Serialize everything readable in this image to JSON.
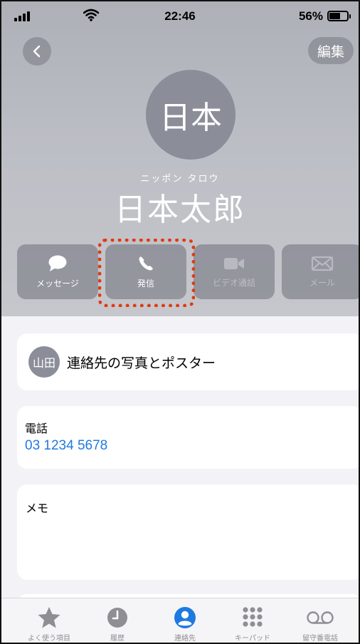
{
  "status_bar": {
    "time": "22:46",
    "battery": "56%",
    "battery_level": 0.56
  },
  "header": {
    "back_label": "<",
    "edit_label": "編集"
  },
  "contact": {
    "avatar_initials": "日本",
    "name_kana": "ニッポン タロウ",
    "name": "日本太郎"
  },
  "actions": [
    {
      "label": "メッセージ",
      "icon": "message-icon",
      "enabled": true
    },
    {
      "label": "発信",
      "icon": "phone-icon",
      "enabled": true,
      "highlighted": true
    },
    {
      "label": "ビデオ通話",
      "icon": "video-icon",
      "enabled": false
    },
    {
      "label": "メール",
      "icon": "mail-icon",
      "enabled": false
    }
  ],
  "cards": {
    "photo": {
      "avatar_initials": "山田",
      "label": "連絡先の写真とポスター"
    },
    "phone": {
      "label": "電話",
      "number": "03 1234 5678"
    },
    "memo": {
      "label": "メモ"
    }
  },
  "tabs": [
    {
      "label": "よく使う項目",
      "icon": "star-icon",
      "active": false
    },
    {
      "label": "履歴",
      "icon": "clock-icon",
      "active": false
    },
    {
      "label": "連絡先",
      "icon": "person-icon",
      "active": true
    },
    {
      "label": "キーパッド",
      "icon": "keypad-icon",
      "active": false
    },
    {
      "label": "留守番電話",
      "icon": "voicemail-icon",
      "active": false
    }
  ],
  "colors": {
    "accent": "#1f7ae0",
    "highlight": "#e03a12",
    "avatar": "#8b8e99"
  }
}
